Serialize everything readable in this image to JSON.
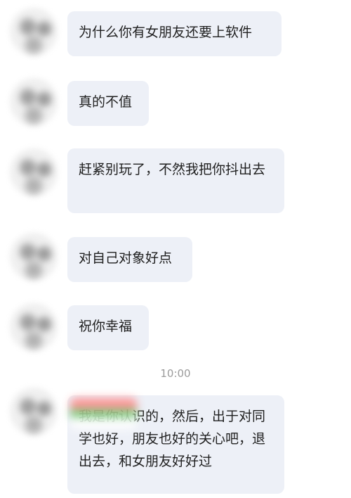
{
  "messages": [
    {
      "text": "为什么你有女朋友还要上软件"
    },
    {
      "text": "真的不值"
    },
    {
      "text": "赶紧别玩了，不然我把你抖出去"
    },
    {
      "text": "对自己对象好点"
    },
    {
      "text": "祝你幸福"
    }
  ],
  "timestamp": "10:00",
  "last_message": {
    "text": "我是你认识的，然后，出于对同学也好，朋友也好的关心吧，退出去，和女朋友好好过"
  },
  "colors": {
    "bubble_bg": "#edf0f7",
    "text": "#1f1f1f",
    "timestamp": "#9b9b9b"
  }
}
